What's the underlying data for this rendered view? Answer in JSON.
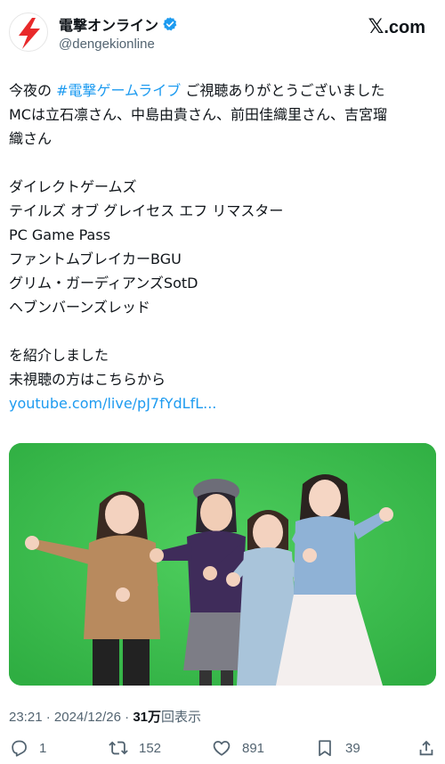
{
  "header": {
    "display_name": "電撃オンライン",
    "handle": "@dengekionline",
    "brand_x": "𝕏",
    "brand_com": ".com",
    "verified_color": "#1d9bf0",
    "avatar_color": "#e8292a"
  },
  "tweet": {
    "lines": [
      {
        "pre": "今夜の ",
        "hashtag": "#電撃ゲームライブ",
        "post": " ご視聴ありがとうございました"
      },
      {
        "text": "MCは立石凛さん、中島由貴さん、前田佳織里さん、吉宮瑠"
      },
      {
        "text": "織さん"
      },
      {
        "text": "ダイレクトゲームズ"
      },
      {
        "text": "テイルズ オブ グレイセス エフ リマスター"
      },
      {
        "text": "PC Game Pass"
      },
      {
        "text": "ファントムブレイカーBGU"
      },
      {
        "text": "グリム・ガーディアンズSotD"
      },
      {
        "text": "ヘブンバーンズレッド"
      },
      {
        "text": "を紹介しました"
      },
      {
        "text": "未視聴の方はこちらから"
      }
    ],
    "link": "youtube.com/live/pJ7fYdLfL..."
  },
  "meta": {
    "time": "23:21",
    "sep1": " · ",
    "date": "2024/12/26",
    "sep2": " · ",
    "views_count": "31万",
    "views_label": "回表示"
  },
  "actions": {
    "replies": "1",
    "reposts": "152",
    "likes": "891",
    "bookmarks": "39"
  },
  "colors": {
    "accent": "#1d9bf0",
    "text": "#0f1419",
    "muted": "#536471",
    "photo_background": "#3ec24f"
  }
}
